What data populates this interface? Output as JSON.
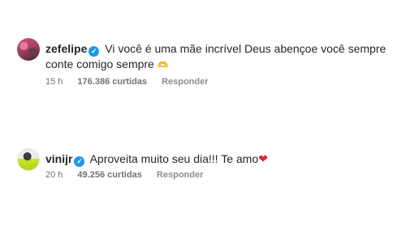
{
  "comments": [
    {
      "username": "zefelipe",
      "text": "Vi você é uma mãe incrível Deus abençoe você sempre conte comigo sempre",
      "emoji": "🫶",
      "time": "15 h",
      "likes": "176.386 curtidas",
      "reply_label": "Responder"
    },
    {
      "username": "vinijr",
      "text": "Aproveita muito seu dia!!! Te amo",
      "emoji": "❤",
      "time": "20 h",
      "likes": "49.256 curtidas",
      "reply_label": "Responder"
    }
  ],
  "icons": {
    "verified": "verified-badge-icon"
  },
  "colors": {
    "verified": "#1c96f0",
    "heart": "#e0243a",
    "meta": "#737373"
  }
}
